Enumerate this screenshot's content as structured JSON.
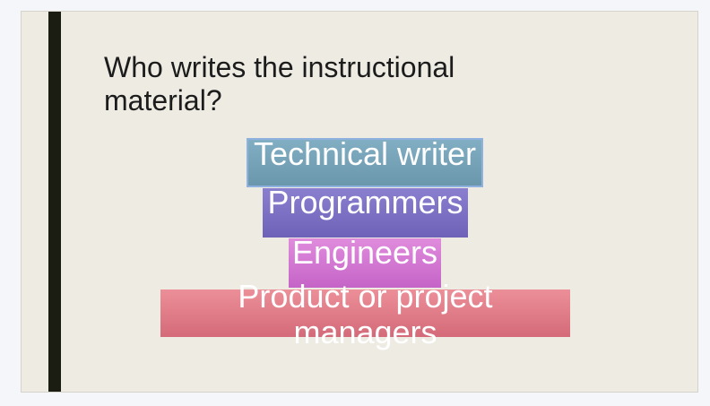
{
  "slide": {
    "title": "Who writes the instructional material?",
    "tiers": [
      {
        "label": "Technical writer"
      },
      {
        "label": "Programmers"
      },
      {
        "label": "Engineers"
      },
      {
        "label": "Product or project managers"
      }
    ],
    "colors": {
      "background": "#eeebe3",
      "accent_bar": "#1b1d12",
      "tier_1": "#7aa5bb",
      "tier_2": "#7b6fc3",
      "tier_3": "#d47ad3",
      "tier_4": "#e17d88"
    }
  }
}
